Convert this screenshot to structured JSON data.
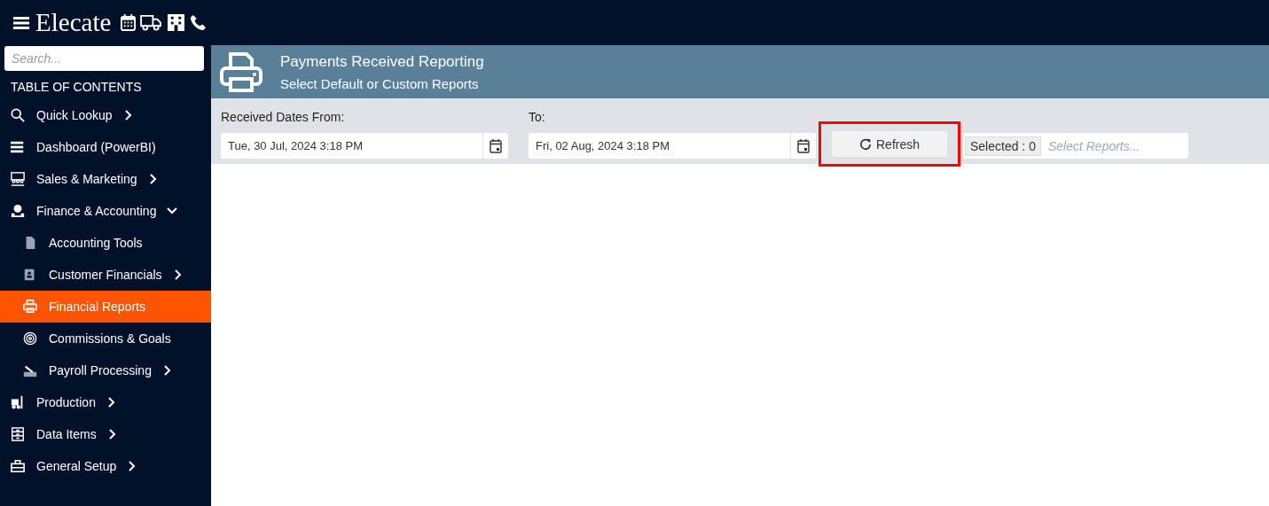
{
  "app": {
    "brand": "Elecate"
  },
  "sidebar": {
    "search": {
      "placeholder": "Search..."
    },
    "heading": "TABLE OF CONTENTS",
    "items": [
      {
        "label": "Quick Lookup",
        "selected": false,
        "expanded": false
      },
      {
        "label": "Dashboard (PowerBI)",
        "selected": false
      },
      {
        "label": "Sales & Marketing",
        "selected": false,
        "expanded": false
      },
      {
        "label": "Finance & Accounting",
        "selected": false,
        "expanded": true,
        "children": [
          {
            "label": "Accounting Tools",
            "selected": false
          },
          {
            "label": "Customer Financials",
            "selected": false,
            "expanded": false
          },
          {
            "label": "Financial Reports",
            "selected": true
          },
          {
            "label": "Commissions & Goals",
            "selected": false
          },
          {
            "label": "Payroll Processing",
            "selected": false,
            "expanded": false
          }
        ]
      },
      {
        "label": "Production",
        "selected": false,
        "expanded": false
      },
      {
        "label": "Data Items",
        "selected": false,
        "expanded": false
      },
      {
        "label": "General Setup",
        "selected": false,
        "expanded": false
      }
    ]
  },
  "page": {
    "title": "Payments Received Reporting",
    "subtitle": "Select Default or Custom Reports"
  },
  "filters": {
    "from_label": "Received Dates From:",
    "from_value": "Tue, 30 Jul, 2024 3:18 PM",
    "to_label": "To:",
    "to_value": "Fri, 02 Aug, 2024 3:18 PM",
    "refresh": {
      "label": "Refresh",
      "highlighted": true
    },
    "selected_count": "Selected : 0",
    "reports_placeholder": "Select Reports..."
  }
}
